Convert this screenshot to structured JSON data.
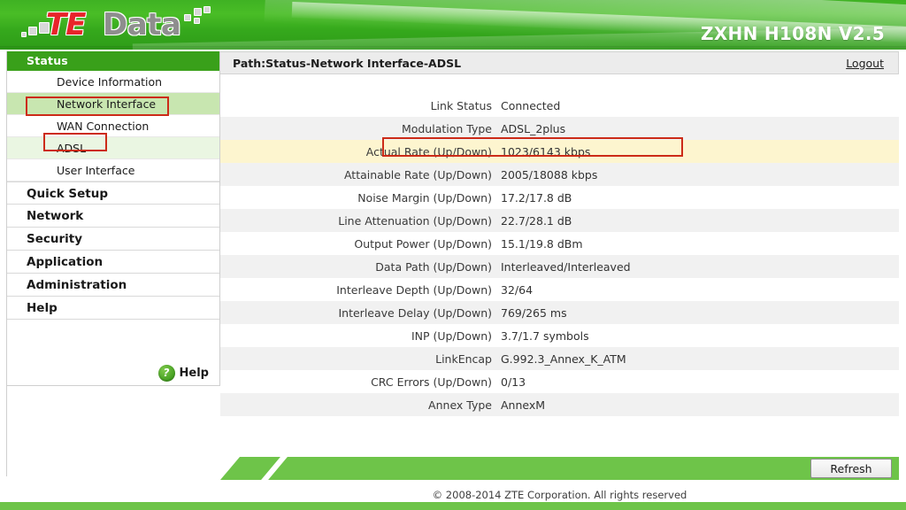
{
  "header": {
    "logo_te": "TE",
    "logo_data": "Data",
    "model": "ZXHN H108N V2.5"
  },
  "sidebar": {
    "header_label": "Status",
    "items": [
      {
        "label": "Device Information",
        "level": "sub",
        "state": "normal"
      },
      {
        "label": "Network Interface",
        "level": "sub",
        "state": "selected-strong"
      },
      {
        "label": "WAN Connection",
        "level": "subsub",
        "state": "normal"
      },
      {
        "label": "ADSL",
        "level": "subsub",
        "state": "selected-light"
      },
      {
        "label": "User Interface",
        "level": "sub",
        "state": "normal"
      }
    ],
    "top_items": [
      {
        "label": "Quick Setup"
      },
      {
        "label": "Network"
      },
      {
        "label": "Security"
      },
      {
        "label": "Application"
      },
      {
        "label": "Administration"
      },
      {
        "label": "Help"
      }
    ],
    "help": {
      "icon": "question-mark-circle-icon",
      "label": "Help",
      "glyph": "?"
    }
  },
  "pathbar": {
    "path": "Path:Status-Network Interface-ADSL",
    "logout": "Logout"
  },
  "table": {
    "rows": [
      {
        "key": "Link Status",
        "value": "Connected"
      },
      {
        "key": "Modulation Type",
        "value": "ADSL_2plus"
      },
      {
        "key": "Actual Rate (Up/Down)",
        "value": "1023/6143 kbps"
      },
      {
        "key": "Attainable Rate (Up/Down)",
        "value": "2005/18088 kbps"
      },
      {
        "key": "Noise Margin (Up/Down)",
        "value": "17.2/17.8 dB"
      },
      {
        "key": "Line Attenuation (Up/Down)",
        "value": "22.7/28.1 dB"
      },
      {
        "key": "Output Power (Up/Down)",
        "value": "15.1/19.8 dBm"
      },
      {
        "key": "Data Path (Up/Down)",
        "value": "Interleaved/Interleaved"
      },
      {
        "key": "Interleave Depth (Up/Down)",
        "value": "32/64"
      },
      {
        "key": "Interleave Delay (Up/Down)",
        "value": "769/265 ms"
      },
      {
        "key": "INP (Up/Down)",
        "value": "3.7/1.7 symbols"
      },
      {
        "key": "LinkEncap",
        "value": "G.992.3_Annex_K_ATM"
      },
      {
        "key": "CRC Errors (Up/Down)",
        "value": "0/13"
      },
      {
        "key": "Annex Type",
        "value": "AnnexM"
      }
    ],
    "highlight_row_index": 2
  },
  "footer": {
    "refresh_label": "Refresh",
    "copyright": "© 2008-2014 ZTE Corporation. All rights reserved"
  },
  "annotations": {
    "color": "#cc2b18",
    "boxes": [
      "network-interface",
      "adsl",
      "actual-rate-row"
    ]
  },
  "colors": {
    "brand_green": "#49bd26",
    "nav_header_green": "#39a01a",
    "selected_strong": "#c8e6b0",
    "selected_light": "#eaf6e2",
    "highlight_yellow": "#fdf5cf",
    "footer_green": "#6ec449",
    "logo_red": "#e8242a",
    "logo_gray": "#8e8e8e"
  }
}
